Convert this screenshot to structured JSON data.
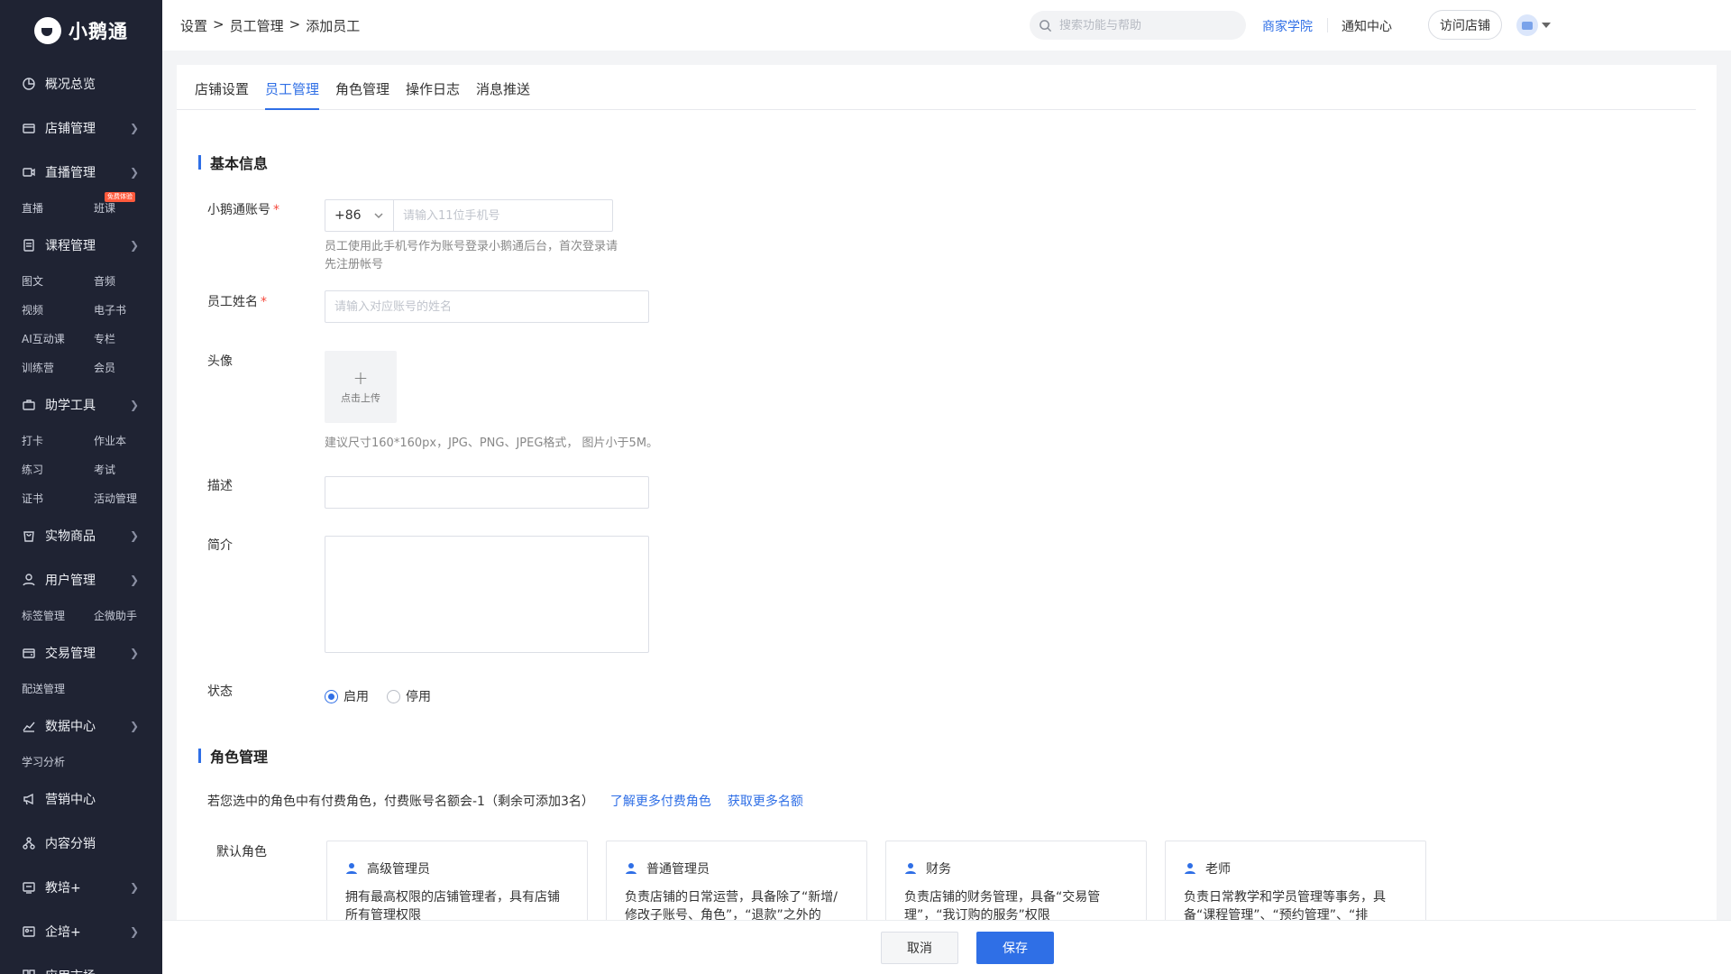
{
  "app": {
    "logo_text": "小鹅通"
  },
  "sidebar": {
    "items": [
      {
        "label": "概况总览",
        "icon": "overview-icon",
        "chevron": false,
        "subs": []
      },
      {
        "label": "店铺管理",
        "icon": "store-icon",
        "chevron": true,
        "subs": []
      },
      {
        "label": "直播管理",
        "icon": "live-icon",
        "chevron": true,
        "subs": [
          "直播",
          "班课"
        ]
      },
      {
        "label": "课程管理",
        "icon": "course-icon",
        "chevron": true,
        "subs": [
          "图文",
          "音频",
          "视频",
          "电子书",
          "AI互动课",
          "专栏",
          "训练营",
          "会员"
        ]
      },
      {
        "label": "助学工具",
        "icon": "toolbox-icon",
        "chevron": true,
        "subs": [
          "打卡",
          "作业本",
          "练习",
          "考试",
          "证书",
          "活动管理"
        ]
      },
      {
        "label": "实物商品",
        "icon": "goods-icon",
        "chevron": true,
        "subs": []
      },
      {
        "label": "用户管理",
        "icon": "user-icon",
        "chevron": true,
        "subs": [
          "标签管理",
          "企微助手"
        ]
      },
      {
        "label": "交易管理",
        "icon": "wallet-icon",
        "chevron": true,
        "subs": [
          "配送管理"
        ]
      },
      {
        "label": "数据中心",
        "icon": "chart-icon",
        "chevron": true,
        "subs": [
          "学习分析"
        ]
      },
      {
        "label": "营销中心",
        "icon": "megaphone-icon",
        "chevron": false,
        "subs": []
      },
      {
        "label": "内容分销",
        "icon": "distribution-icon",
        "chevron": false,
        "subs": []
      },
      {
        "label": "教培+",
        "icon": "education-icon",
        "chevron": true,
        "subs": []
      },
      {
        "label": "企培+",
        "icon": "enterprise-icon",
        "chevron": true,
        "subs": []
      },
      {
        "label": "应用市场",
        "icon": "apps-icon",
        "chevron": false,
        "subs": []
      }
    ],
    "badge_text": "免费体验"
  },
  "header": {
    "breadcrumb": [
      "设置",
      "员工管理",
      "添加员工"
    ],
    "breadcrumb_sep": ">",
    "search_placeholder": "搜索功能与帮助",
    "link_academy": "商家学院",
    "link_notice": "通知中心",
    "visit_store": "访问店铺"
  },
  "tabs": [
    "店铺设置",
    "员工管理",
    "角色管理",
    "操作日志",
    "消息推送"
  ],
  "active_tab": 1,
  "form": {
    "section_basic": "基本信息",
    "account_label": "小鹅通账号",
    "required_mark": "*",
    "phone_code": "+86",
    "phone_placeholder": "请输入11位手机号",
    "phone_hint": "员工使用此手机号作为账号登录小鹅通后台，首次登录请先注册帐号",
    "name_label": "员工姓名",
    "name_placeholder": "请输入对应账号的姓名",
    "avatar_label": "头像",
    "upload_plus": "+",
    "upload_text": "点击上传",
    "avatar_hint": "建议尺寸160*160px，JPG、PNG、JPEG格式， 图片小于5M。",
    "desc_label": "描述",
    "intro_label": "简介",
    "status_label": "状态",
    "status_enabled": "启用",
    "status_disabled": "停用",
    "status_value": "启用"
  },
  "roles": {
    "section_title": "角色管理",
    "note": "若您选中的角色中有付费角色，付费账号名额会-1（剩余可添加3名）",
    "link_more_paid": "了解更多付费角色",
    "link_more_quota": "获取更多名额",
    "default_label": "默认角色",
    "cards": [
      {
        "name": "高级管理员",
        "desc": "拥有最高权限的店铺管理者，具有店铺所有管理权限"
      },
      {
        "name": "普通管理员",
        "desc": "负责店铺的日常运营，具备除了“新增/修改子账号、角色”，“退款”之外的"
      },
      {
        "name": "财务",
        "desc": "负责店铺的财务管理，具备“交易管理”，“我订购的服务”权限"
      },
      {
        "name": "老师",
        "desc": "负责日常教学和学员管理等事务，具备“课程管理”、“预约管理”、“排"
      }
    ]
  },
  "footer": {
    "cancel": "取消",
    "save": "保存"
  },
  "colors": {
    "primary": "#2f6fe6",
    "sidebar_bg": "#1f2333",
    "required": "#f5483b"
  }
}
